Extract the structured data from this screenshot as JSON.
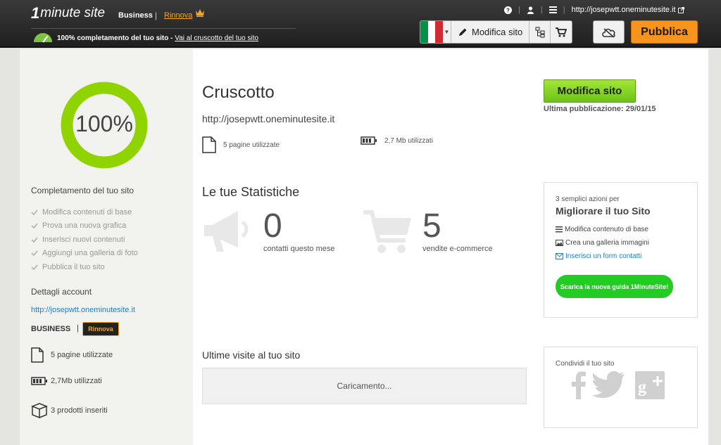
{
  "header": {
    "logo_one": "1",
    "logo_text": "minute site",
    "plan": "Business",
    "separator": "|",
    "renew": "Rinnova",
    "progress_text": "100% completamento del tuo sito - ",
    "progress_link": "Vai al cruscotto del tuo sito",
    "site_url": "http://josepwtt.oneminutesite.it",
    "edit_label": "Modifica sito",
    "publish_label": "Pubblica"
  },
  "sidebar": {
    "percent": "100%",
    "completion_title": "Completamento del tuo sito",
    "checklist": [
      "Modifica contenuti di base",
      "Prova una nuova grafica",
      "Inserisci nuovi contenuti",
      "Aggiungi una galleria di foto",
      "Pubblica il tuo sito"
    ],
    "details_title": "Dettagli account",
    "account_url": "http://josepwtt.oneminutesite.it",
    "plan": "BUSINESS",
    "separator": "|",
    "renew": "Rinnova",
    "pages": "5 pagine utilizzate",
    "storage": "2,7Mb utilizzati",
    "products": "3 prodotti inseriti"
  },
  "main": {
    "title": "Cruscotto",
    "url": "http://josepwtt.oneminutesite.it",
    "pages": "5 pagine utilizzate",
    "storage": "2,7 Mb utilizzati",
    "stats_title": "Le tue Statistiche",
    "contacts_count": "0",
    "contacts_label": "contatti questo mese",
    "sales_count": "5",
    "sales_label": "vendite e-commerce",
    "visits_title": "Ultime visite al tuo sito",
    "loading": "Caricamento..."
  },
  "aside": {
    "edit_button": "Modifica sito",
    "last_publish": "Ultima pubblicazione: 29/01/15",
    "actions_intro": "3 semplici azioni per",
    "actions_title": "Migliorare il tuo Sito",
    "action_1": "Modifica contenuto di base",
    "action_2": "Crea una galleria immagini",
    "action_3": "Inserisci un form contatti",
    "guide_button": "Scarica la nuova guida 1MinuteSite!",
    "share_title": "Condividi il tuo sito"
  },
  "colors": {
    "accent_orange": "#f7941d",
    "green": "#8fd400",
    "link_blue": "#1f7fc5"
  }
}
